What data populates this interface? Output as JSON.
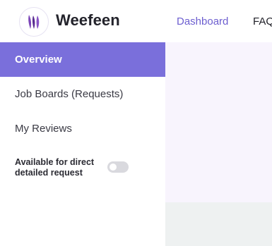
{
  "brand": {
    "name": "Weefeen",
    "logo_icon": "feather-logo-icon",
    "logo_color": "#6a3aa0"
  },
  "nav": {
    "dashboard": "Dashboard",
    "faq": "FAQ"
  },
  "sidebar": {
    "items": [
      {
        "label": "Overview",
        "active": true
      },
      {
        "label": "Job Boards (Requests)",
        "active": false
      },
      {
        "label": "My Reviews",
        "active": false
      }
    ],
    "availability": {
      "label": "Available for direct detailed request",
      "enabled": false
    }
  },
  "colors": {
    "accent": "#7a6fdb",
    "nav_link": "#6d5fd0",
    "main_bg": "#f8f4fd",
    "footer_bg": "#eef1f1"
  }
}
